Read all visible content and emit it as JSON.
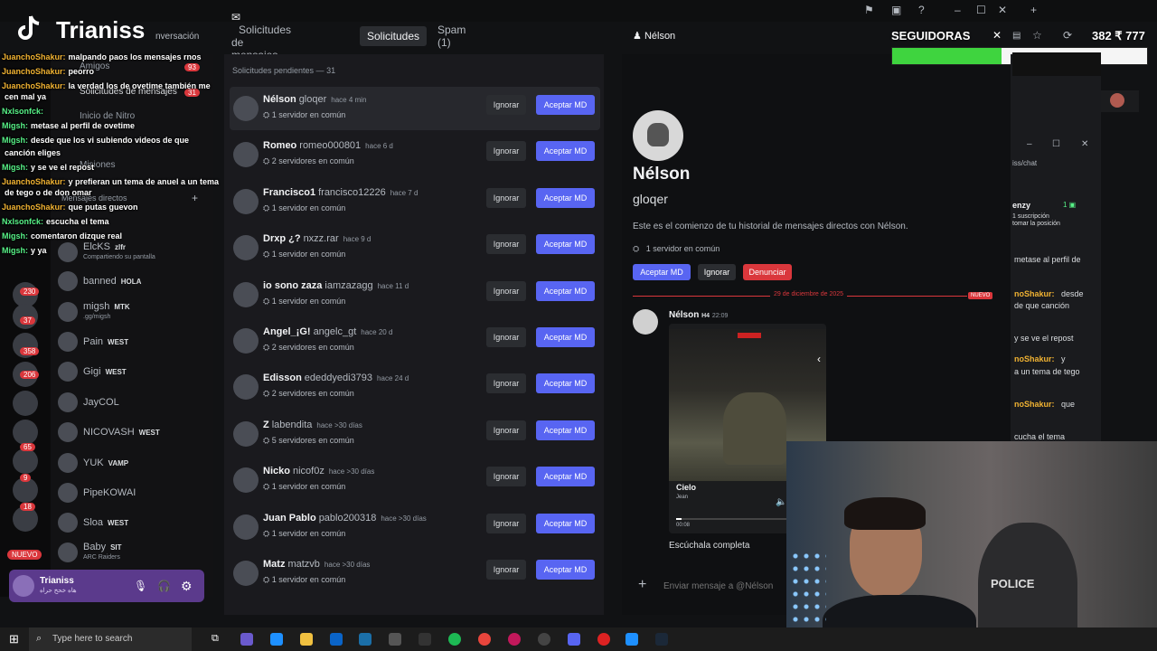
{
  "overlay": {
    "streamer_name": "Trianiss",
    "followers_label": "SEGUIDORAS",
    "followers_count": "382 ₹ 777"
  },
  "tabs": {
    "conversation": "nversación",
    "message_requests": "Solicitudes de mensajes",
    "requests": "Solicitudes",
    "spam": "Spam (1)"
  },
  "left_nav": {
    "friends": "Amigos",
    "message_requests": "Solicitudes de mensajes",
    "message_requests_badge": "31",
    "nitro": "Inicio de Nitro",
    "missions": "Misiones",
    "direct_messages": "Mensajes directos",
    "friends_badge": "93"
  },
  "chat_overlay": [
    {
      "user": "JuanchoShakur:",
      "msg": "malpando paos los mensajes rnos"
    },
    {
      "user": "JuanchoShakur:",
      "msg": "peorro"
    },
    {
      "user": "JuanchoShakur:",
      "msg": "la verdad los de ovetime también me"
    },
    {
      "user": "",
      "msg": "cen mal ya"
    },
    {
      "user": "Nxlsonfck:",
      "msg": ""
    },
    {
      "user": "Migsh:",
      "msg": "metase al perfil de ovetime"
    },
    {
      "user": "Migsh:",
      "msg": "desde que los vi subiendo videos de que"
    },
    {
      "user": "",
      "msg": "canción eliges"
    },
    {
      "user": "Migsh:",
      "msg": "y se ve el repost"
    },
    {
      "user": "JuanchoShakur:",
      "msg": "y prefieran un tema de anuel a un tema"
    },
    {
      "user": "",
      "msg": "de tego o de don omar"
    },
    {
      "user": "JuanchoShakur:",
      "msg": "que putas guevon"
    },
    {
      "user": "Nxlsonfck:",
      "msg": "escucha el tema"
    },
    {
      "user": "Migsh:",
      "msg": "comentaron dizque real"
    },
    {
      "user": "Migsh:",
      "msg": "y ya"
    }
  ],
  "dm_list": [
    {
      "name": "ElcKS",
      "tag": "zlfr",
      "sub": "Compartiendo su pantalla"
    },
    {
      "name": "banned",
      "tag": "HOLA",
      "sub": ""
    },
    {
      "name": "migsh",
      "tag": "MTK",
      "sub": ".gg/migsh"
    },
    {
      "name": "Pain",
      "tag": "WEST",
      "sub": ""
    },
    {
      "name": "Gigi",
      "tag": "WEST",
      "sub": ""
    },
    {
      "name": "JayCOL",
      "tag": "",
      "sub": ""
    },
    {
      "name": "NICOVASH",
      "tag": "WEST",
      "sub": ""
    },
    {
      "name": "YUK",
      "tag": "VAMP",
      "sub": ""
    },
    {
      "name": "PipeKOWAI",
      "tag": "",
      "sub": ""
    },
    {
      "name": "Sloa",
      "tag": "WEST",
      "sub": ""
    },
    {
      "name": "Baby",
      "tag": "SIT",
      "sub": "ARC Raiders"
    }
  ],
  "user_panel": {
    "name": "Trianiss",
    "status": "هاه خحخ حراه"
  },
  "rail_badges": [
    "230",
    "37",
    "358",
    "206",
    "65",
    "9",
    "18"
  ],
  "rail_new": "NUEVO",
  "requests_header": "Solicitudes pendientes — 31",
  "requests": [
    {
      "name": "Nélson",
      "username": "gloqer",
      "time": "hace 4 min",
      "common": "1 servidor en común"
    },
    {
      "name": "Romeo",
      "username": "romeo000801",
      "time": "hace 6 d",
      "common": "2 servidores en común"
    },
    {
      "name": "Francisco1",
      "username": "francisco12226",
      "time": "hace 7 d",
      "common": "1 servidor en común"
    },
    {
      "name": "Drxp ¿?",
      "username": "nxzz.rar",
      "time": "hace 9 d",
      "common": "1 servidor en común"
    },
    {
      "name": "io sono zaza",
      "username": "iamzazagg",
      "time": "hace 11 d",
      "common": "1 servidor en común"
    },
    {
      "name": "Angel_¡G!",
      "username": "angelc_gt",
      "time": "hace 20 d",
      "common": "2 servidores en común"
    },
    {
      "name": "Edisson",
      "username": "ededdyedi3793",
      "time": "hace 24 d",
      "common": "2 servidores en común"
    },
    {
      "name": "Z",
      "username": "labendita",
      "time": "hace >30 días",
      "common": "5 servidores en común"
    },
    {
      "name": "Nicko",
      "username": "nicof0z",
      "time": "hace >30 días",
      "common": "1 servidor en común"
    },
    {
      "name": "Juan Pablo",
      "username": "pablo200318",
      "time": "hace >30 días",
      "common": "1 servidor en común"
    },
    {
      "name": "Matz",
      "username": "matzvb",
      "time": "hace >30 días",
      "common": "1 servidor en común"
    }
  ],
  "btn_ignore": "Ignorar",
  "btn_accept": "Aceptar MD",
  "profile": {
    "header_name": "Nélson",
    "display_name": "Nélson",
    "username": "gloqer",
    "intro": "Este es el comienzo de tu historial de mensajes directos con Nélson.",
    "common": "1 servidor en común",
    "accept": "Aceptar MD",
    "ignore": "Ignorar",
    "report": "Denunciar",
    "date_divider": "29 de diciembre de 2025",
    "new_badge": "NUEVO",
    "msg_author": "Nélson",
    "msg_tag": "H4",
    "msg_time": "22:09",
    "track_title": "Cielo",
    "track_artist": "Jean",
    "track_time": "00:08",
    "msg_text": "Escúchala completa",
    "input_placeholder": "Enviar mensaje a @Nélson"
  },
  "right_col": {
    "url": "iss/chat",
    "user1": "enzy",
    "sub_info": "1 suscripción",
    "sub_info2": "tomar la posición",
    "line1": "metase al perfil de",
    "line2a": "noShakur:",
    "line2b": "desde",
    "line2c": "de que canción",
    "line3": "y se ve el repost",
    "line4a": "noShakur:",
    "line4b": "y",
    "line4c": "a un tema de tego",
    "line5a": "noShakur:",
    "line5b": "que",
    "line6": "cucha el tema"
  },
  "taskbar": {
    "search_placeholder": "Type here to search"
  },
  "webcam": {
    "chair_text": "POLICE"
  },
  "colors": {
    "accent": "#5865f2",
    "danger": "#da373c",
    "follower_bar": "#3fd43f"
  }
}
